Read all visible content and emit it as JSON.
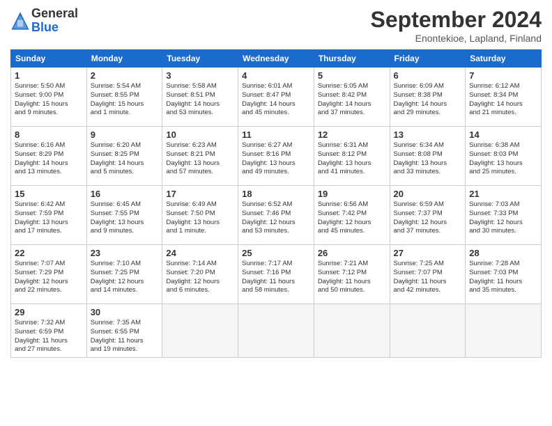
{
  "logo": {
    "general": "General",
    "blue": "Blue"
  },
  "title": "September 2024",
  "subtitle": "Enontekioe, Lapland, Finland",
  "headers": [
    "Sunday",
    "Monday",
    "Tuesday",
    "Wednesday",
    "Thursday",
    "Friday",
    "Saturday"
  ],
  "weeks": [
    [
      {
        "day": 1,
        "info": "Sunrise: 5:50 AM\nSunset: 9:00 PM\nDaylight: 15 hours\nand 9 minutes."
      },
      {
        "day": 2,
        "info": "Sunrise: 5:54 AM\nSunset: 8:55 PM\nDaylight: 15 hours\nand 1 minute."
      },
      {
        "day": 3,
        "info": "Sunrise: 5:58 AM\nSunset: 8:51 PM\nDaylight: 14 hours\nand 53 minutes."
      },
      {
        "day": 4,
        "info": "Sunrise: 6:01 AM\nSunset: 8:47 PM\nDaylight: 14 hours\nand 45 minutes."
      },
      {
        "day": 5,
        "info": "Sunrise: 6:05 AM\nSunset: 8:42 PM\nDaylight: 14 hours\nand 37 minutes."
      },
      {
        "day": 6,
        "info": "Sunrise: 6:09 AM\nSunset: 8:38 PM\nDaylight: 14 hours\nand 29 minutes."
      },
      {
        "day": 7,
        "info": "Sunrise: 6:12 AM\nSunset: 8:34 PM\nDaylight: 14 hours\nand 21 minutes."
      }
    ],
    [
      {
        "day": 8,
        "info": "Sunrise: 6:16 AM\nSunset: 8:29 PM\nDaylight: 14 hours\nand 13 minutes."
      },
      {
        "day": 9,
        "info": "Sunrise: 6:20 AM\nSunset: 8:25 PM\nDaylight: 14 hours\nand 5 minutes."
      },
      {
        "day": 10,
        "info": "Sunrise: 6:23 AM\nSunset: 8:21 PM\nDaylight: 13 hours\nand 57 minutes."
      },
      {
        "day": 11,
        "info": "Sunrise: 6:27 AM\nSunset: 8:16 PM\nDaylight: 13 hours\nand 49 minutes."
      },
      {
        "day": 12,
        "info": "Sunrise: 6:31 AM\nSunset: 8:12 PM\nDaylight: 13 hours\nand 41 minutes."
      },
      {
        "day": 13,
        "info": "Sunrise: 6:34 AM\nSunset: 8:08 PM\nDaylight: 13 hours\nand 33 minutes."
      },
      {
        "day": 14,
        "info": "Sunrise: 6:38 AM\nSunset: 8:03 PM\nDaylight: 13 hours\nand 25 minutes."
      }
    ],
    [
      {
        "day": 15,
        "info": "Sunrise: 6:42 AM\nSunset: 7:59 PM\nDaylight: 13 hours\nand 17 minutes."
      },
      {
        "day": 16,
        "info": "Sunrise: 6:45 AM\nSunset: 7:55 PM\nDaylight: 13 hours\nand 9 minutes."
      },
      {
        "day": 17,
        "info": "Sunrise: 6:49 AM\nSunset: 7:50 PM\nDaylight: 13 hours\nand 1 minute."
      },
      {
        "day": 18,
        "info": "Sunrise: 6:52 AM\nSunset: 7:46 PM\nDaylight: 12 hours\nand 53 minutes."
      },
      {
        "day": 19,
        "info": "Sunrise: 6:56 AM\nSunset: 7:42 PM\nDaylight: 12 hours\nand 45 minutes."
      },
      {
        "day": 20,
        "info": "Sunrise: 6:59 AM\nSunset: 7:37 PM\nDaylight: 12 hours\nand 37 minutes."
      },
      {
        "day": 21,
        "info": "Sunrise: 7:03 AM\nSunset: 7:33 PM\nDaylight: 12 hours\nand 30 minutes."
      }
    ],
    [
      {
        "day": 22,
        "info": "Sunrise: 7:07 AM\nSunset: 7:29 PM\nDaylight: 12 hours\nand 22 minutes."
      },
      {
        "day": 23,
        "info": "Sunrise: 7:10 AM\nSunset: 7:25 PM\nDaylight: 12 hours\nand 14 minutes."
      },
      {
        "day": 24,
        "info": "Sunrise: 7:14 AM\nSunset: 7:20 PM\nDaylight: 12 hours\nand 6 minutes."
      },
      {
        "day": 25,
        "info": "Sunrise: 7:17 AM\nSunset: 7:16 PM\nDaylight: 11 hours\nand 58 minutes."
      },
      {
        "day": 26,
        "info": "Sunrise: 7:21 AM\nSunset: 7:12 PM\nDaylight: 11 hours\nand 50 minutes."
      },
      {
        "day": 27,
        "info": "Sunrise: 7:25 AM\nSunset: 7:07 PM\nDaylight: 11 hours\nand 42 minutes."
      },
      {
        "day": 28,
        "info": "Sunrise: 7:28 AM\nSunset: 7:03 PM\nDaylight: 11 hours\nand 35 minutes."
      }
    ],
    [
      {
        "day": 29,
        "info": "Sunrise: 7:32 AM\nSunset: 6:59 PM\nDaylight: 11 hours\nand 27 minutes."
      },
      {
        "day": 30,
        "info": "Sunrise: 7:35 AM\nSunset: 6:55 PM\nDaylight: 11 hours\nand 19 minutes."
      },
      null,
      null,
      null,
      null,
      null
    ]
  ]
}
